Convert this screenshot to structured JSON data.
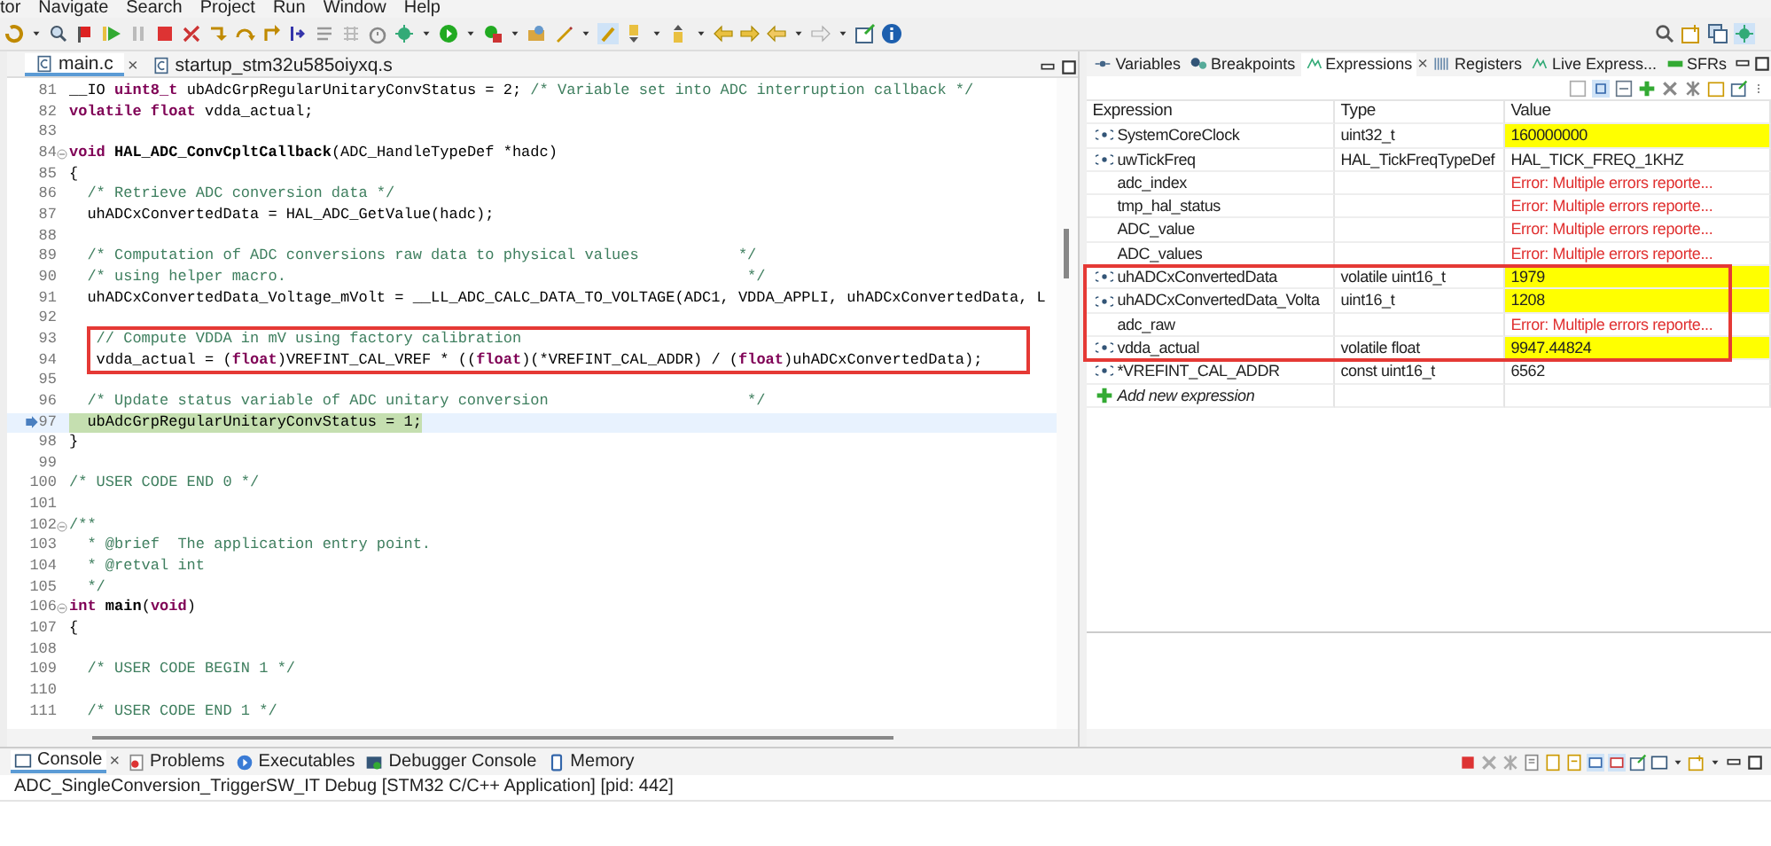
{
  "menu": [
    "tor",
    "Navigate",
    "Search",
    "Project",
    "Run",
    "Window",
    "Help"
  ],
  "editor": {
    "tabs": [
      {
        "label": "main.c",
        "selected": true,
        "close": "×"
      },
      {
        "label": "startup_stm32u585oiyxq.s",
        "selected": false
      }
    ],
    "lines": [
      {
        "number": "81",
        "fold": false,
        "current": false,
        "boxed": false,
        "tokens": [
          {
            "kind": "code",
            "text": "__IO "
          },
          {
            "kind": "kw",
            "text": "uint8_t"
          },
          {
            "kind": "code",
            "text": " ubAdcGrpRegularUnitaryConvStatus = 2; "
          },
          {
            "kind": "comment",
            "text": "/* Variable set into ADC interruption callback */"
          }
        ]
      },
      {
        "number": "82",
        "fold": false,
        "current": false,
        "boxed": false,
        "tokens": [
          {
            "kind": "kw",
            "text": "volatile float"
          },
          {
            "kind": "code",
            "text": " vdda_actual;"
          }
        ]
      },
      {
        "number": "83",
        "fold": false,
        "current": false,
        "boxed": false
      },
      {
        "number": "84",
        "fold": true,
        "current": false,
        "boxed": false,
        "tokens": [
          {
            "kind": "kw",
            "text": "void"
          },
          {
            "kind": "fn",
            "text": " HAL_ADC_ConvCpltCallback"
          },
          {
            "kind": "code",
            "text": "(ADC_HandleTypeDef *hadc)"
          }
        ]
      },
      {
        "number": "85",
        "fold": false,
        "current": false,
        "boxed": false,
        "tokens": [
          {
            "kind": "code",
            "text": "{"
          }
        ]
      },
      {
        "number": "86",
        "fold": false,
        "current": false,
        "boxed": false,
        "tokens": [
          {
            "kind": "comment",
            "text": "  /* Retrieve ADC conversion data */"
          }
        ]
      },
      {
        "number": "87",
        "fold": false,
        "current": false,
        "boxed": false,
        "tokens": [
          {
            "kind": "code",
            "text": "  uhADCxConvertedData = HAL_ADC_GetValue(hadc);"
          }
        ]
      },
      {
        "number": "88",
        "fold": false,
        "current": false,
        "boxed": false
      },
      {
        "number": "89",
        "fold": false,
        "current": false,
        "boxed": false,
        "tokens": [
          {
            "kind": "comment",
            "text": "  /* Computation of ADC conversions raw data to physical values           */"
          }
        ]
      },
      {
        "number": "90",
        "fold": false,
        "current": false,
        "boxed": false,
        "tokens": [
          {
            "kind": "comment",
            "text": "  /* using helper macro.                                                   */"
          }
        ]
      },
      {
        "number": "91",
        "fold": false,
        "current": false,
        "boxed": false,
        "tokens": [
          {
            "kind": "code",
            "text": "  uhADCxConvertedData_Voltage_mVolt = __LL_ADC_CALC_DATA_TO_VOLTAGE(ADC1, VDDA_APPLI, uhADCxConvertedData, L"
          }
        ]
      },
      {
        "number": "92",
        "fold": false,
        "current": false,
        "boxed": false
      },
      {
        "number": "93",
        "fold": false,
        "current": false,
        "boxed": true,
        "tokens": [
          {
            "kind": "comment",
            "text": "   // Compute VDDA in mV using factory calibration"
          }
        ]
      },
      {
        "number": "94",
        "fold": false,
        "current": false,
        "boxed": true,
        "tokens": [
          {
            "kind": "code",
            "text": "   vdda_actual = ("
          },
          {
            "kind": "kw",
            "text": "float"
          },
          {
            "kind": "code",
            "text": ")VREFINT_CAL_VREF * (("
          },
          {
            "kind": "kw",
            "text": "float"
          },
          {
            "kind": "code",
            "text": ")(*VREFINT_CAL_ADDR) / ("
          },
          {
            "kind": "kw",
            "text": "float"
          },
          {
            "kind": "code",
            "text": ")uhADCxConvertedData);"
          }
        ]
      },
      {
        "number": "95",
        "fold": false,
        "current": false,
        "boxed": false
      },
      {
        "number": "96",
        "fold": false,
        "current": false,
        "boxed": false,
        "tokens": [
          {
            "kind": "comment",
            "text": "  /* Update status variable of ADC unitary conversion                      */"
          }
        ]
      },
      {
        "number": "97",
        "fold": false,
        "current": true,
        "boxed": false,
        "tokens": [
          {
            "kind": "code",
            "text": "  ubAdcGrpRegularUnitaryConvStatus = 1;"
          }
        ]
      },
      {
        "number": "98",
        "fold": false,
        "current": false,
        "boxed": false,
        "tokens": [
          {
            "kind": "code",
            "text": "}"
          }
        ]
      },
      {
        "number": "99",
        "fold": false,
        "current": false,
        "boxed": false
      },
      {
        "number": "100",
        "fold": false,
        "current": false,
        "boxed": false,
        "tokens": [
          {
            "kind": "comment",
            "text": "/* USER CODE END 0 */"
          }
        ]
      },
      {
        "number": "101",
        "fold": false,
        "current": false,
        "boxed": false
      },
      {
        "number": "102",
        "fold": true,
        "current": false,
        "boxed": false,
        "tokens": [
          {
            "kind": "comment",
            "text": "/**"
          }
        ]
      },
      {
        "number": "103",
        "fold": false,
        "current": false,
        "boxed": false,
        "tokens": [
          {
            "kind": "comment",
            "text": "  * @brief  The application entry point."
          }
        ]
      },
      {
        "number": "104",
        "fold": false,
        "current": false,
        "boxed": false,
        "tokens": [
          {
            "kind": "comment",
            "text": "  * @retval int"
          }
        ]
      },
      {
        "number": "105",
        "fold": false,
        "current": false,
        "boxed": false,
        "tokens": [
          {
            "kind": "comment",
            "text": "  */"
          }
        ]
      },
      {
        "number": "106",
        "fold": true,
        "current": false,
        "boxed": false,
        "tokens": [
          {
            "kind": "kw",
            "text": "int"
          },
          {
            "kind": "fn",
            "text": " main"
          },
          {
            "kind": "code",
            "text": "("
          },
          {
            "kind": "kw",
            "text": "void"
          },
          {
            "kind": "code",
            "text": ")"
          }
        ]
      },
      {
        "number": "107",
        "fold": false,
        "current": false,
        "boxed": false,
        "tokens": [
          {
            "kind": "code",
            "text": "{"
          }
        ]
      },
      {
        "number": "108",
        "fold": false,
        "current": false,
        "boxed": false
      },
      {
        "number": "109",
        "fold": false,
        "current": false,
        "boxed": false,
        "tokens": [
          {
            "kind": "comment",
            "text": "  /* USER CODE BEGIN 1 */"
          }
        ]
      },
      {
        "number": "110",
        "fold": false,
        "current": false,
        "boxed": false
      },
      {
        "number": "111",
        "fold": false,
        "current": false,
        "boxed": false,
        "tokens": [
          {
            "kind": "comment",
            "text": "  /* USER CODE END 1 */"
          }
        ]
      }
    ]
  },
  "views": {
    "tabs": [
      {
        "label": "Variables",
        "selected": false
      },
      {
        "label": "Breakpoints",
        "selected": false
      },
      {
        "label": "Expressions",
        "selected": true,
        "close": "×"
      },
      {
        "label": "Registers",
        "selected": false
      },
      {
        "label": "Live Express...",
        "selected": false
      },
      {
        "label": "SFRs",
        "selected": false
      }
    ]
  },
  "expressions": {
    "columns": [
      "Expression",
      "Type",
      "Value"
    ],
    "rows": [
      {
        "kind": "variable",
        "expression": "SystemCoreClock",
        "type": "uint32_t",
        "value": "160000000",
        "changed": true,
        "boxed": false
      },
      {
        "kind": "variable",
        "expression": "uwTickFreq",
        "type": "HAL_TickFreqTypeDef",
        "value": "HAL_TICK_FREQ_1KHZ",
        "changed": false,
        "boxed": false
      },
      {
        "kind": "error",
        "expression": "adc_index",
        "value": "Error: Multiple errors reporte...",
        "changed": false,
        "boxed": false
      },
      {
        "kind": "error",
        "expression": "tmp_hal_status",
        "value": "Error: Multiple errors reporte...",
        "changed": false,
        "boxed": false
      },
      {
        "kind": "error",
        "expression": "ADC_value",
        "value": "Error: Multiple errors reporte...",
        "changed": false,
        "boxed": false
      },
      {
        "kind": "error",
        "expression": "ADC_values",
        "value": "Error: Multiple errors reporte...",
        "changed": false,
        "boxed": false
      },
      {
        "kind": "variable",
        "expression": "uhADCxConvertedData",
        "type": "volatile uint16_t",
        "value": "1979",
        "changed": true,
        "boxed": true
      },
      {
        "kind": "variable",
        "expression": "uhADCxConvertedData_Volta",
        "type": "uint16_t",
        "value": "1208",
        "changed": true,
        "boxed": true
      },
      {
        "kind": "error",
        "expression": "adc_raw",
        "value": "Error: Multiple errors reporte...",
        "changed": false,
        "boxed": true
      },
      {
        "kind": "variable",
        "expression": "vdda_actual",
        "type": "volatile float",
        "value": "9947.44824",
        "changed": true,
        "boxed": true
      },
      {
        "kind": "variable",
        "expression": "*VREFINT_CAL_ADDR",
        "type": "const uint16_t",
        "value": "6562",
        "changed": false,
        "boxed": false
      }
    ],
    "add_label": "Add new expression"
  },
  "console": {
    "tabs": [
      {
        "label": "Console",
        "selected": true,
        "close": "×"
      },
      {
        "label": "Problems",
        "selected": false
      },
      {
        "label": "Executables",
        "selected": false
      },
      {
        "label": "Debugger Console",
        "selected": false
      },
      {
        "label": "Memory",
        "selected": false
      }
    ],
    "title": "ADC_SingleConversion_TriggerSW_IT Debug [STM32 C/C++ Application]  [pid: 442]"
  }
}
